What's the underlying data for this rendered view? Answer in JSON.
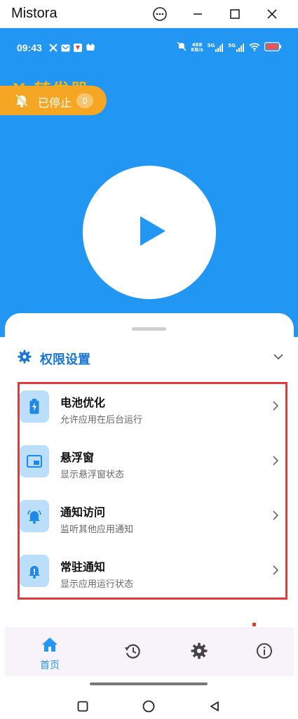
{
  "window": {
    "title": "Mistora"
  },
  "status_bar": {
    "time": "09:43",
    "net_speed_value": "468",
    "net_speed_unit": "KB/s",
    "sim1": "5G",
    "sim2": "5G"
  },
  "app": {
    "title": "X 转发器"
  },
  "status_pill": {
    "label": "已停止",
    "count": "0"
  },
  "permissions": {
    "header": "权限设置",
    "items": [
      {
        "title": "电池优化",
        "subtitle": "允许应用在后台运行",
        "icon": "battery-icon"
      },
      {
        "title": "悬浮窗",
        "subtitle": "显示悬浮窗状态",
        "icon": "picture-in-picture-icon"
      },
      {
        "title": "通知访问",
        "subtitle": "监听其他应用通知",
        "icon": "bell-ring-icon"
      },
      {
        "title": "常驻通知",
        "subtitle": "显示应用运行状态",
        "icon": "bell-alert-icon"
      }
    ]
  },
  "bottom_nav": {
    "home_label": "首页"
  },
  "colors": {
    "primary": "#2196f3",
    "accent": "#f5a623",
    "highlight": "#e03a3a",
    "tile": "#bbdefb"
  }
}
